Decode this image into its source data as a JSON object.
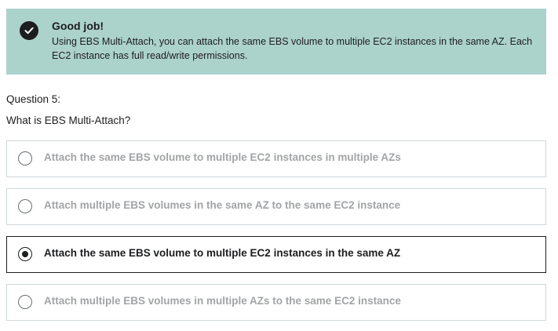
{
  "alert": {
    "icon": "check-circle-icon",
    "title": "Good job!",
    "body": "Using EBS Multi-Attach, you can attach the same EBS volume to multiple EC2 instances in the same AZ. Each EC2 instance has full read/write permissions."
  },
  "question": {
    "number_label": "Question 5:",
    "prompt": "What is EBS Multi-Attach?"
  },
  "options": [
    {
      "label": "Attach the same EBS volume to multiple EC2 instances in multiple AZs",
      "selected": false
    },
    {
      "label": "Attach multiple EBS volumes in the same AZ to the same EC2 instance",
      "selected": false
    },
    {
      "label": "Attach the same EBS volume to multiple EC2 instances in the same AZ",
      "selected": true
    },
    {
      "label": "Attach multiple EBS volumes in multiple AZs to the same EC2 instance",
      "selected": false
    }
  ],
  "colors": {
    "alert_bg": "#acd2cc",
    "text": "#1c1d1f",
    "muted_text": "#a2a4a6",
    "border": "#d1d7dc"
  }
}
